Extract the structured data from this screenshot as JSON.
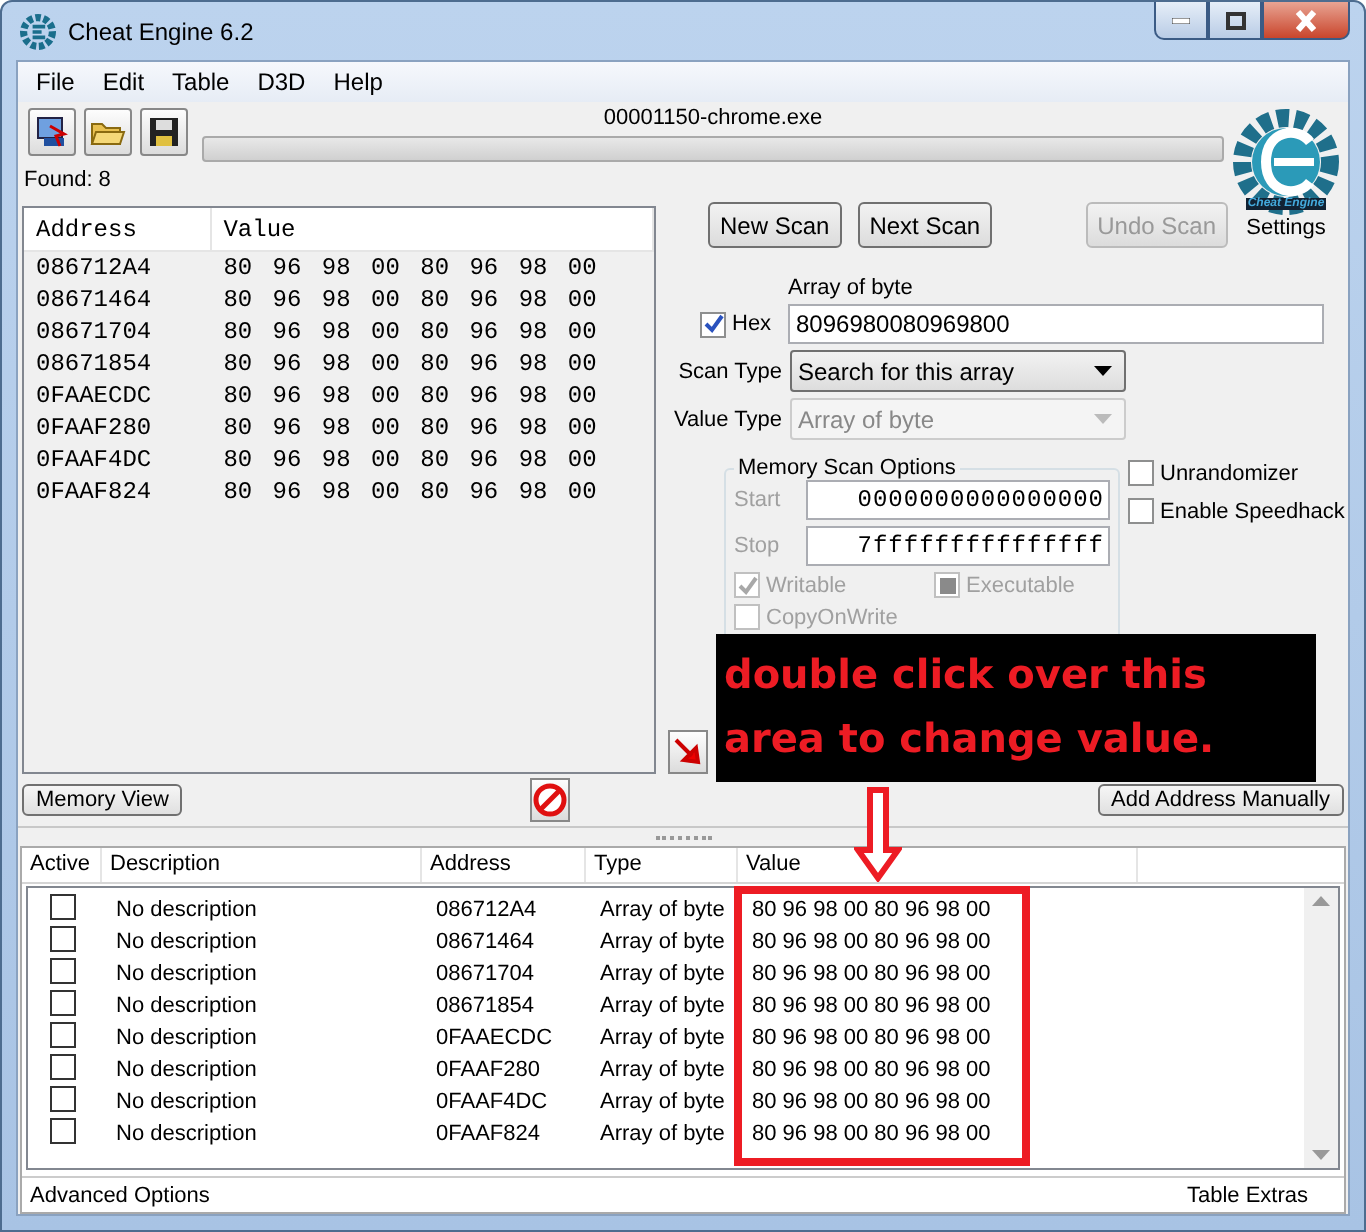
{
  "window": {
    "title": "Cheat Engine 6.2"
  },
  "menu": [
    "File",
    "Edit",
    "Table",
    "D3D",
    "Help"
  ],
  "process": "00001150-chrome.exe",
  "progress": {
    "level": 0
  },
  "found": "Found: 8",
  "results": {
    "columns": [
      "Address",
      "Value"
    ],
    "rows": [
      {
        "address": "086712A4",
        "value": "80 96 98 00 80 96 98 00"
      },
      {
        "address": "08671464",
        "value": "80 96 98 00 80 96 98 00"
      },
      {
        "address": "08671704",
        "value": "80 96 98 00 80 96 98 00"
      },
      {
        "address": "08671854",
        "value": "80 96 98 00 80 96 98 00"
      },
      {
        "address": "0FAAECDC",
        "value": "80 96 98 00 80 96 98 00"
      },
      {
        "address": "0FAAF280",
        "value": "80 96 98 00 80 96 98 00"
      },
      {
        "address": "0FAAF4DC",
        "value": "80 96 98 00 80 96 98 00"
      },
      {
        "address": "0FAAF824",
        "value": "80 96 98 00 80 96 98 00"
      }
    ]
  },
  "scan_buttons": [
    {
      "label": "New Scan",
      "disabled": false
    },
    {
      "label": "Next Scan",
      "disabled": false
    },
    {
      "label": "Undo Scan",
      "disabled": true
    }
  ],
  "logo": {
    "text": "Cheat Engine",
    "label": "Settings"
  },
  "value_label": "Array of byte",
  "hex": {
    "label": "Hex",
    "checked": true
  },
  "value_input": "8096980080969800",
  "scan_type": {
    "label": "Scan Type",
    "value": "Search for this array",
    "disabled": false
  },
  "value_type": {
    "label": "Value Type",
    "value": "Array of byte",
    "disabled": true
  },
  "memory_scan_options": {
    "title": "Memory Scan Options",
    "start": {
      "label": "Start",
      "value": "0000000000000000"
    },
    "stop": {
      "label": "Stop",
      "value": "7fffffffffffffff"
    },
    "options": [
      {
        "label": "Writable",
        "checked": true,
        "indeterminate": false
      },
      {
        "label": "Executable",
        "checked": false,
        "indeterminate": true
      },
      {
        "label": "CopyOnWrite",
        "checked": false,
        "indeterminate": false
      }
    ]
  },
  "side_options": [
    {
      "label": "Unrandomizer",
      "checked": false
    },
    {
      "label": "Enable Speedhack",
      "checked": false
    }
  ],
  "memory_view_button": "Memory View",
  "add_address_button": "Add Address Manually",
  "annotation": "double click over this area to change value.",
  "address_list": {
    "columns": [
      "Active",
      "Description",
      "Address",
      "Type",
      "Value"
    ],
    "rows": [
      {
        "active": false,
        "description": "No description",
        "address": "086712A4",
        "type": "Array of byte",
        "value": "80 96 98 00 80 96 98 00"
      },
      {
        "active": false,
        "description": "No description",
        "address": "08671464",
        "type": "Array of byte",
        "value": "80 96 98 00 80 96 98 00"
      },
      {
        "active": false,
        "description": "No description",
        "address": "08671704",
        "type": "Array of byte",
        "value": "80 96 98 00 80 96 98 00"
      },
      {
        "active": false,
        "description": "No description",
        "address": "08671854",
        "type": "Array of byte",
        "value": "80 96 98 00 80 96 98 00"
      },
      {
        "active": false,
        "description": "No description",
        "address": "0FAAECDC",
        "type": "Array of byte",
        "value": "80 96 98 00 80 96 98 00"
      },
      {
        "active": false,
        "description": "No description",
        "address": "0FAAF280",
        "type": "Array of byte",
        "value": "80 96 98 00 80 96 98 00"
      },
      {
        "active": false,
        "description": "No description",
        "address": "0FAAF4DC",
        "type": "Array of byte",
        "value": "80 96 98 00 80 96 98 00"
      },
      {
        "active": false,
        "description": "No description",
        "address": "0FAAF824",
        "type": "Array of byte",
        "value": "80 96 98 00 80 96 98 00"
      }
    ]
  },
  "status_bar": {
    "left": "Advanced Options",
    "right": "Table Extras"
  }
}
